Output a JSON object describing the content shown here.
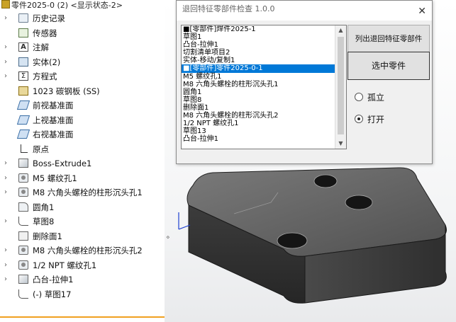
{
  "tree": {
    "header": "零件2025-0 (2) <显示状态-2>",
    "items": [
      {
        "label": "历史记录",
        "icon": "history-folder-icon",
        "expand": true
      },
      {
        "label": "传感器",
        "icon": "sensor-icon",
        "expand": false
      },
      {
        "label": "注解",
        "icon": "annotation-icon",
        "expand": true
      },
      {
        "label": "实体(2)",
        "icon": "solid-body-icon",
        "expand": true
      },
      {
        "label": "方程式",
        "icon": "equation-icon",
        "expand": true
      },
      {
        "label": "1023 碳钢板 (SS)",
        "icon": "material-icon",
        "expand": false
      },
      {
        "label": "前视基准面",
        "icon": "plane-icon",
        "expand": false
      },
      {
        "label": "上视基准面",
        "icon": "plane-icon",
        "expand": false
      },
      {
        "label": "右视基准面",
        "icon": "plane-icon",
        "expand": false
      },
      {
        "label": "原点",
        "icon": "origin-icon",
        "expand": false
      },
      {
        "label": "Boss-Extrude1",
        "icon": "extrude-icon",
        "expand": true
      },
      {
        "label": "M5 螺纹孔1",
        "icon": "hole-icon",
        "expand": true
      },
      {
        "label": "M8 六角头螺栓的柱形沉头孔1",
        "icon": "hole-icon",
        "expand": true
      },
      {
        "label": "圆角1",
        "icon": "fillet-icon",
        "expand": false
      },
      {
        "label": "草图8",
        "icon": "sketch-icon",
        "expand": true
      },
      {
        "label": "删除面1",
        "icon": "delete-face-icon",
        "expand": false
      },
      {
        "label": "M8 六角头螺栓的柱形沉头孔2",
        "icon": "hole-icon",
        "expand": true
      },
      {
        "label": "1/2 NPT 螺纹孔1",
        "icon": "hole-icon",
        "expand": true
      },
      {
        "label": "凸台-拉伸1",
        "icon": "extrude-icon",
        "expand": true
      },
      {
        "label": "(-) 草图17",
        "icon": "sketch-icon",
        "expand": false
      }
    ]
  },
  "dialog": {
    "title": "退回特征零部件检查 1.0.0",
    "close_glyph": "✕",
    "list_items": [
      "■[零部件]焊件2025-1",
      "草图1",
      "凸台-拉伸1",
      "切割清单项目2",
      "实体-移动/复制1",
      "■[零部件]零件2025-0-1",
      "M5 螺纹孔1",
      "M8 六角头螺栓的柱形沉头孔1",
      "圆角1",
      "草图8",
      "删除面1",
      "M8 六角头螺栓的柱形沉头孔2",
      "1/2 NPT 螺纹孔1",
      "草图13",
      "凸台-拉伸1"
    ],
    "selected_index": 5,
    "btn_list": "列出退回特征零部件",
    "btn_select": "选中零件",
    "radio_isolate": "孤立",
    "radio_open": "打开",
    "radio_selected": "open"
  },
  "colors": {
    "selection": "#0078d7",
    "tree_accent": "#f0a020",
    "part_body": "#5a5a5a"
  }
}
